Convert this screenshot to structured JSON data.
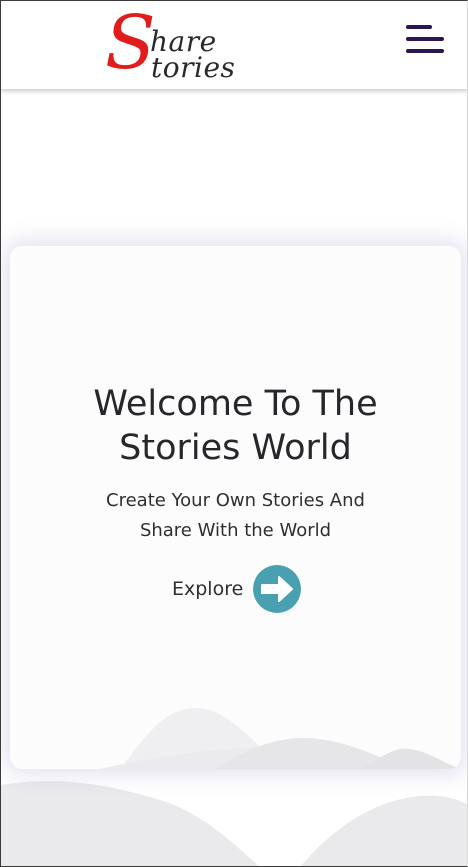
{
  "header": {
    "logo": {
      "big_letter": "S",
      "line1": "hare",
      "line2": "tories"
    },
    "menu_icon": "hamburger-menu-icon"
  },
  "hero": {
    "title_line1": "Welcome To The",
    "title_line2": "Stories World",
    "subtitle_line1": "Create Your Own Stories And",
    "subtitle_line2": "Share With the World",
    "explore_label": "Explore",
    "explore_icon": "arrow-right-icon"
  },
  "colors": {
    "logo_red": "#e21b1b",
    "menu_purple": "#2c1650",
    "explore_teal": "#49a0b0",
    "wave_gray": "#e8e8ea"
  }
}
